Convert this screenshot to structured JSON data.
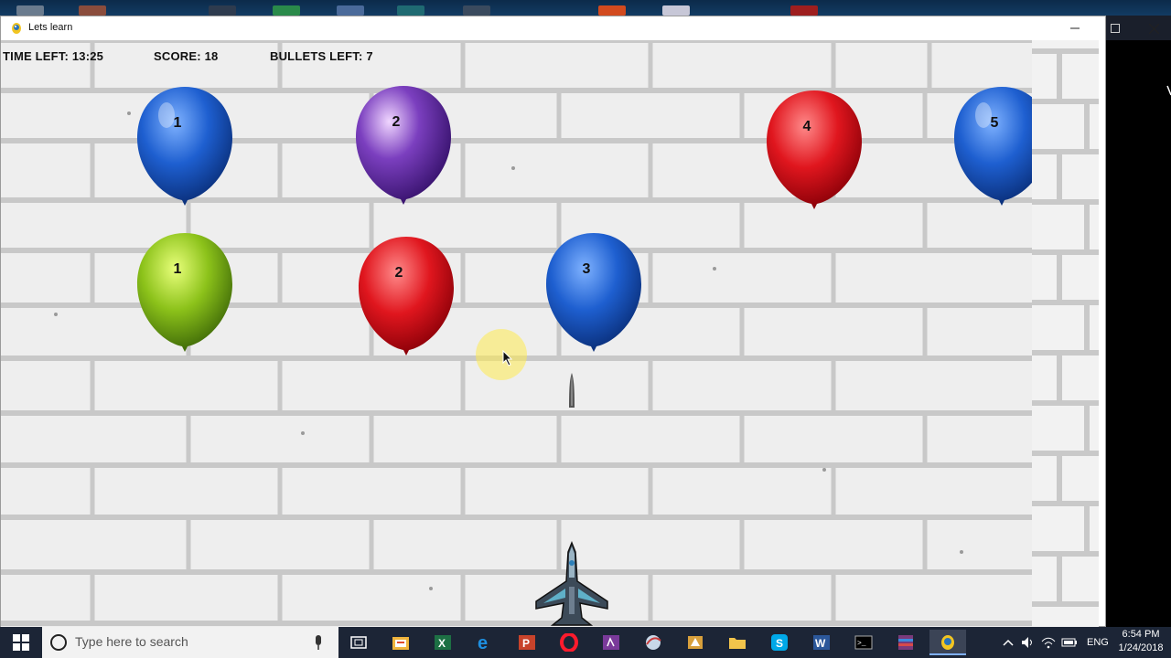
{
  "window": {
    "title": "Lets learn"
  },
  "hud": {
    "time_left": "TIME LEFT: 13:25",
    "score": "SCORE: 18",
    "bullets_left": "BULLETS LEFT: 7"
  },
  "balloons": [
    {
      "number": "1",
      "color": "blue"
    },
    {
      "number": "2",
      "color": "purple"
    },
    {
      "number": "4",
      "color": "red"
    },
    {
      "number": "5",
      "color": "blue"
    },
    {
      "number": "1",
      "color": "green"
    },
    {
      "number": "2",
      "color": "red"
    },
    {
      "number": "3",
      "color": "blue"
    }
  ],
  "colors": {
    "blue": "#1e5fd0",
    "purple": "#7b3fbf",
    "red": "#e0161e",
    "green": "#8cc21a",
    "taskbar": "#1c2536"
  },
  "taskbar": {
    "search_placeholder": "Type here to search",
    "language": "ENG",
    "time": "6:54 PM",
    "date": "1/24/2018",
    "icons": [
      "task-view-icon",
      "file-explorer-folder-icon",
      "excel-icon",
      "edge-icon",
      "powerpoint-icon",
      "opera-icon",
      "onenote-icon",
      "browser-icon",
      "app-icon",
      "folder-icon",
      "skype-icon",
      "word-icon",
      "terminal-icon",
      "winrar-icon",
      "python-icon"
    ]
  }
}
